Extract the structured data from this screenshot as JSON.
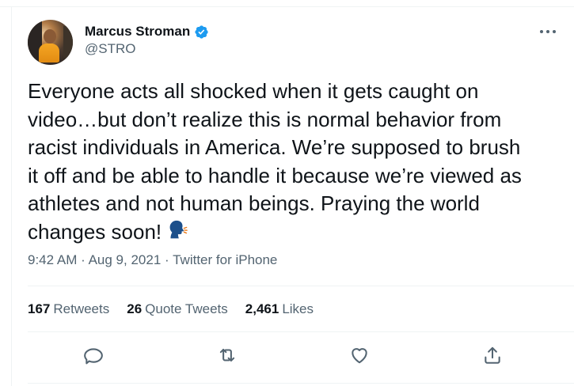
{
  "author": {
    "display_name": "Marcus Stroman",
    "handle": "@STRO",
    "verified": true
  },
  "tweet": {
    "text": "Everyone acts all shocked when it gets caught on\nvideo…but don’t realize this is normal behavior from\nracist individuals in America. We’re supposed to brush\nit off and be able to handle it because we’re viewed as\nathletes and not human beings. Praying the world\nchanges soon!",
    "emoji": "speaking-head"
  },
  "meta": {
    "time": "9:42 AM",
    "separator": "·",
    "date": "Aug 9, 2021",
    "source": "Twitter for iPhone"
  },
  "stats": {
    "retweets": {
      "count": "167",
      "label": "Retweets"
    },
    "quote_tweets": {
      "count": "26",
      "label": "Quote Tweets"
    },
    "likes": {
      "count": "2,461",
      "label": "Likes"
    }
  },
  "actions": [
    "reply-icon",
    "retweet-icon",
    "like-icon",
    "share-icon"
  ],
  "colors": {
    "primary_text": "#0f1419",
    "secondary_text": "#536471",
    "verified_blue": "#1d9bf0",
    "divider": "#eff3f4"
  }
}
